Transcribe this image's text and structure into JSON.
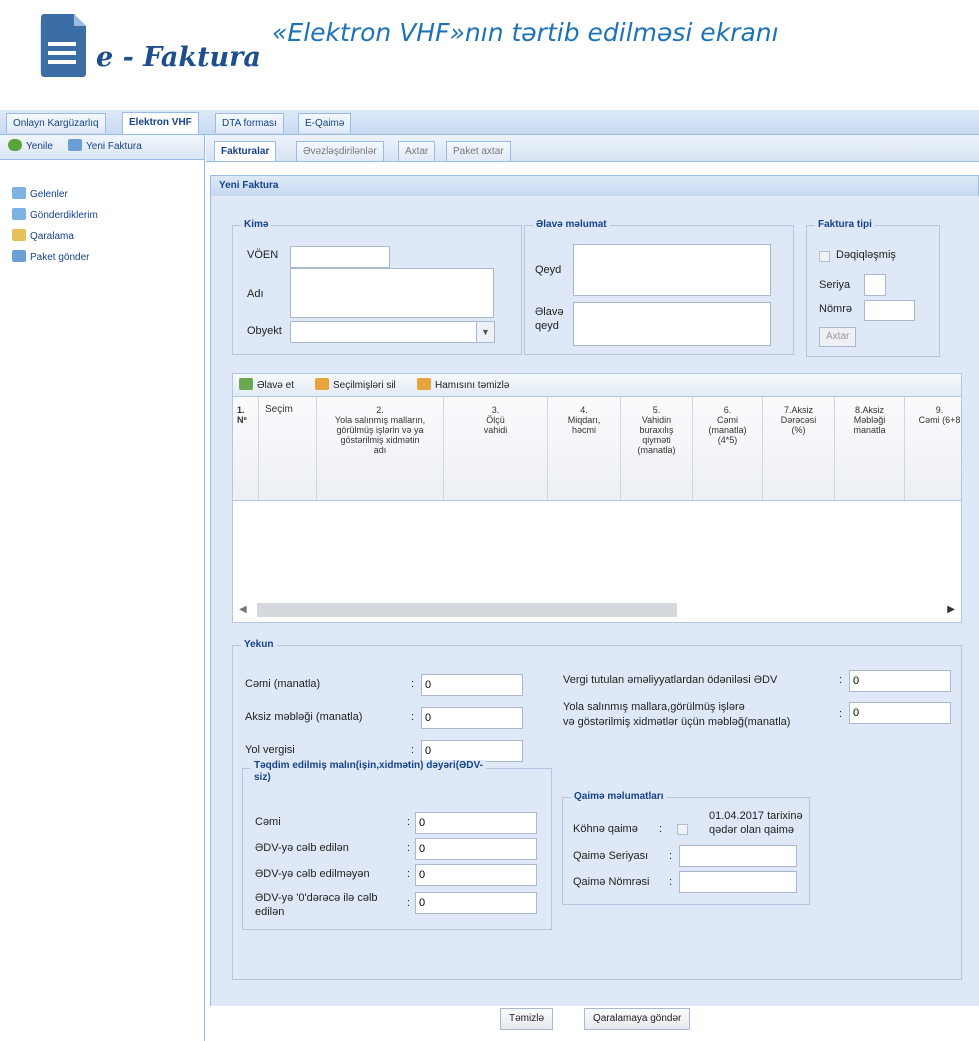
{
  "header": {
    "logo_text": "e - Faktura",
    "title": "«Elektron VHF»nın tərtib edilməsi ekranı"
  },
  "top_tabs": [
    "Onlayn Kargüzarlıq",
    "Elektron VHF",
    "DTA forması",
    "E-Qaimə"
  ],
  "left_toolbar": {
    "refresh": "Yenile",
    "new_invoice": "Yeni Faktura"
  },
  "tree": [
    "Gelenler",
    "Gönderdiklerim",
    "Qaralama",
    "Paket gönder"
  ],
  "sub_tabs": [
    "Fakturalar",
    "Əvəzləşdirilənlər",
    "Axtar",
    "Paket axtar"
  ],
  "panel_title": "Yeni Faktura",
  "kime": {
    "legend": "Kimə",
    "voen_label": "VÖEN",
    "voen": "",
    "adi_label": "Adı",
    "adi": "",
    "obyekt_label": "Obyekt",
    "obyekt": ""
  },
  "elave": {
    "legend": "Əlavə məlumat",
    "qeyd_label": "Qeyd",
    "elave_qeyd_label_1": "Əlavə",
    "elave_qeyd_label_2": "qeyd"
  },
  "faktura_tipi": {
    "legend": "Faktura tipi",
    "deqiq_label": "Dəqiqləşmiş",
    "seriya_label": "Seriya",
    "nomre_label": "Nömrə",
    "search_button": "Axtar"
  },
  "grid_toolbar": {
    "add": "Əlavə et",
    "delete_selected": "Seçilmişləri sil",
    "clear_all": "Hamısını təmizlə"
  },
  "grid_columns": [
    "1.\nNº",
    "Seçim",
    "2.\nYola salınmış malların,\ngörülmüş işlərin və ya\ngöstərilmiş xidmətin\nadı",
    "3.\nÖlçü\nvahidi",
    "4.\nMiqdarı,\nhəcmi",
    "5.\nVahidin\nburaxılış\nqiyməti\n(manatla)",
    "6.\nCəmi\n(manatla)\n(4*5)",
    "7.Aksiz\nDərəcəsi\n(%)",
    "8.Aksiz\nMəbləği\nmanatla",
    "9.\nCəmi (6+8"
  ],
  "yekun": {
    "legend": "Yekun",
    "cemi_label": "Cəmi (manatla)",
    "cemi": "0",
    "aksiz_label": "Aksiz məbləği (manatla)",
    "aksiz": "0",
    "yol_label": "Yol vergisi",
    "yol": "0",
    "edv_label": "Vergi tutulan əməliyyatlardan ödəniləsi ƏDV",
    "edv": "0",
    "yola_label_1": "Yola salınmış mallara,görülmüş işlərə",
    "yola_label_2": "və göstərilmiş xidmətlər üçün məbləğ(manatla)",
    "yola": "0",
    "colon": ":"
  },
  "teqdim": {
    "legend_1": "Təqdim edilmiş malın(işin,xidmətin) dəyəri(ƏDV-",
    "legend_2": "siz)",
    "cemi_label": "Cəmi",
    "cemi": "0",
    "celb_label": "ƏDV-yə cəlb edilən",
    "celb": "0",
    "celb_edilmeyen_label": "ƏDV-yə cəlb edilməyən",
    "celb_edilmeyen": "0",
    "sifir_label_1": "ƏDV-yə '0'dərəcə ilə cəlb",
    "sifir_label_2": "edilən",
    "sifir": "0"
  },
  "qaime": {
    "legend": "Qaimə məlumatları",
    "kohne_label": "Köhnə qaimə",
    "kohne_note_1": "01.04.2017 tarixinə",
    "kohne_note_2": "qədər olan qaimə",
    "seriya_label": "Qaimə Seriyası",
    "seriya": "",
    "nomre_label": "Qaimə Nömrəsi",
    "nomre": ""
  },
  "footer": {
    "clear": "Təmizlə",
    "send_draft": "Qaralamaya göndər"
  },
  "colors": {
    "accent": "#15428b",
    "border": "#99bbe8",
    "panel_bg": "#dfe8f6",
    "title": "#1e73b8"
  }
}
